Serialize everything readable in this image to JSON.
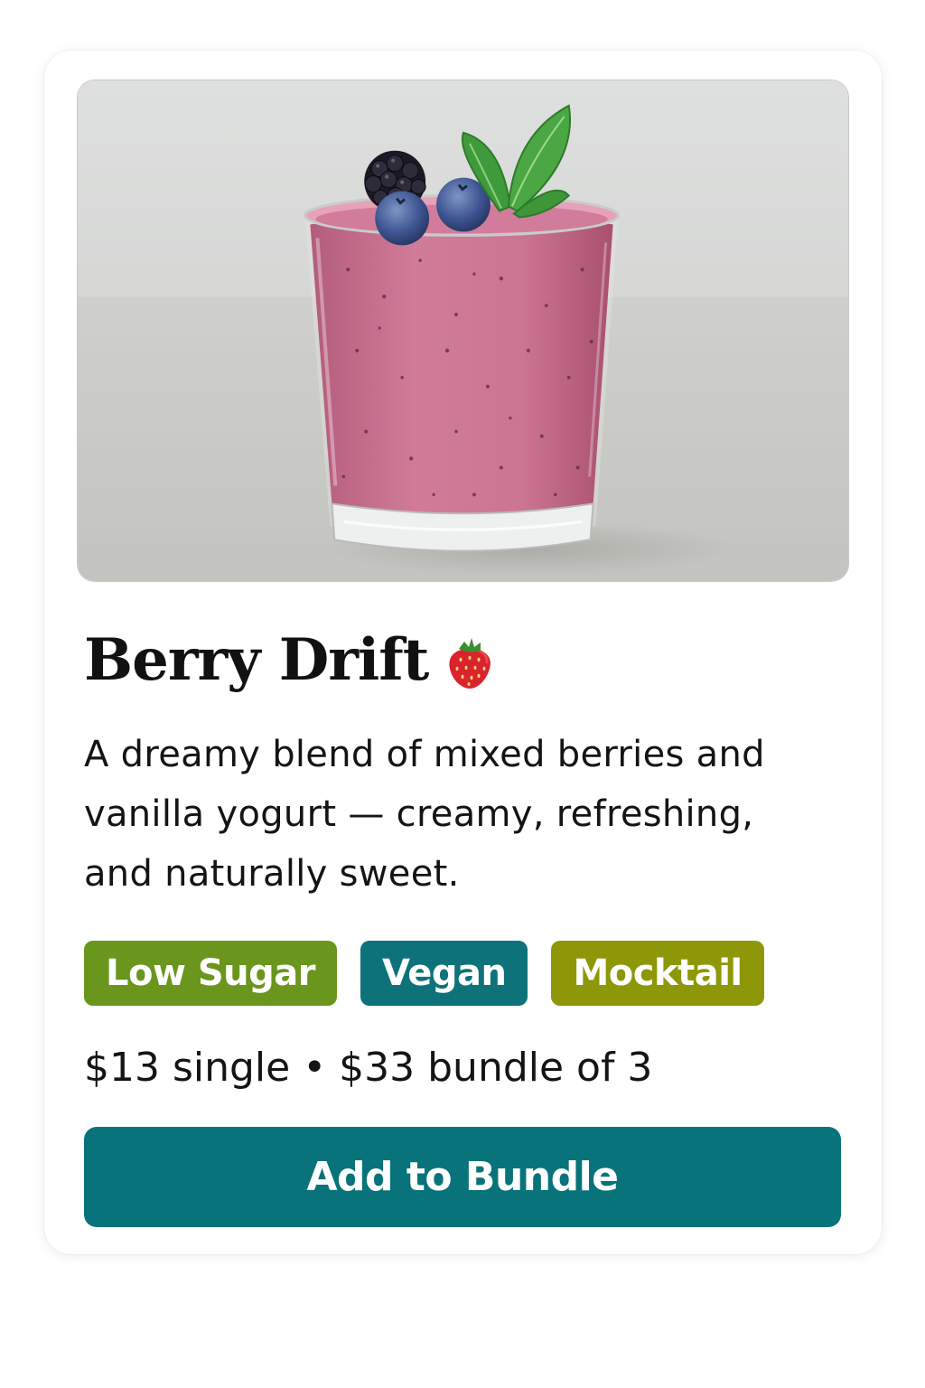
{
  "product": {
    "title": "Berry Drift",
    "title_icon": "strawberry-icon",
    "image_icon": "berry-smoothie-glass-photo",
    "description": "A dreamy blend of mixed berries and vanilla yogurt — creamy, refreshing, and naturally sweet.",
    "tags": [
      {
        "label": "Low Sugar",
        "color": "#6b961e"
      },
      {
        "label": "Vegan",
        "color": "#0d727a"
      },
      {
        "label": "Mocktail",
        "color": "#8e9708"
      }
    ],
    "price_text": "$13 single • $33 bundle of 3"
  },
  "actions": {
    "add_label": "Add to Bundle",
    "add_color": "#08737a"
  },
  "colors": {
    "smoothie": "#c9708f",
    "background_wall": "#dcdddc",
    "background_table": "#cacac6"
  }
}
